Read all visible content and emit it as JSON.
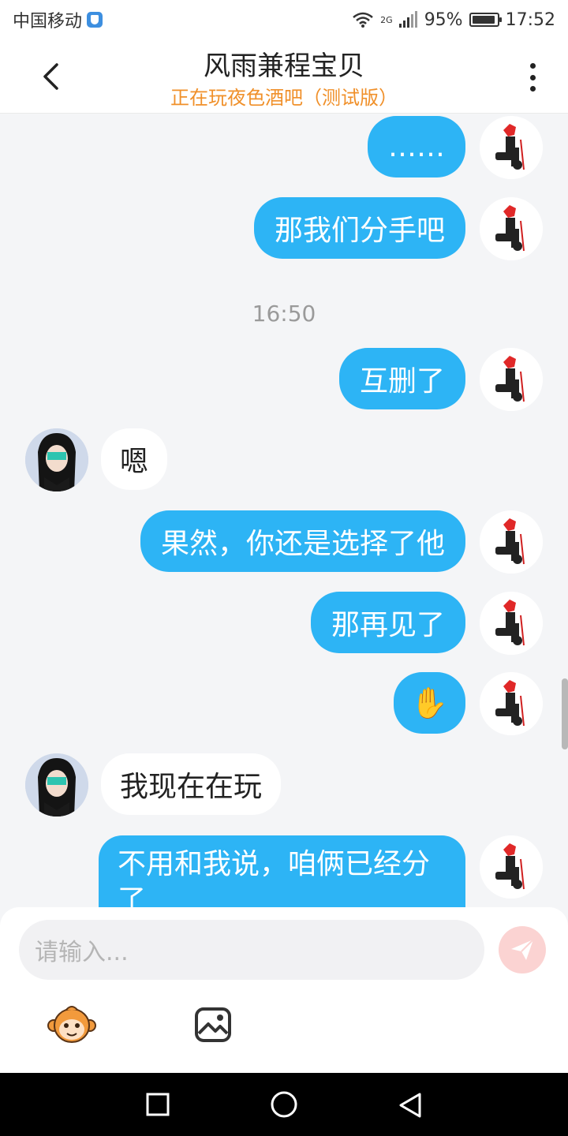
{
  "status": {
    "carrier": "中国移动",
    "network": "2G",
    "battery": "95%",
    "battery_level": 0.95,
    "time": "17:52"
  },
  "header": {
    "title": "风雨兼程宝贝",
    "subtitle": "正在玩夜色酒吧（测试版）"
  },
  "messages": [
    {
      "from": "me",
      "text": "……"
    },
    {
      "from": "me",
      "text": "那我们分手吧"
    },
    {
      "type": "time",
      "text": "16:50"
    },
    {
      "from": "me",
      "text": "互删了"
    },
    {
      "from": "her",
      "text": "嗯"
    },
    {
      "from": "me",
      "text": "果然，你还是选择了他"
    },
    {
      "from": "me",
      "text": "那再见了"
    },
    {
      "from": "me",
      "text": "✋"
    },
    {
      "from": "her",
      "text": "我现在在玩"
    },
    {
      "from": "me",
      "text": "不用和我说，咱俩已经分了"
    }
  ],
  "input": {
    "placeholder": "请输入..."
  },
  "icons": {
    "back": "chevron-left-icon",
    "more": "more-vertical-icon",
    "send": "paper-plane-icon",
    "emoji": "monkey-face-icon",
    "image": "image-icon",
    "nav_back": "triangle-back-icon",
    "nav_home": "circle-home-icon",
    "nav_recent": "square-recent-icon"
  },
  "colors": {
    "outgoing_bubble": "#2db4f5",
    "incoming_bubble": "#ffffff",
    "subtitle": "#f0902a",
    "background": "#f4f5f7"
  }
}
